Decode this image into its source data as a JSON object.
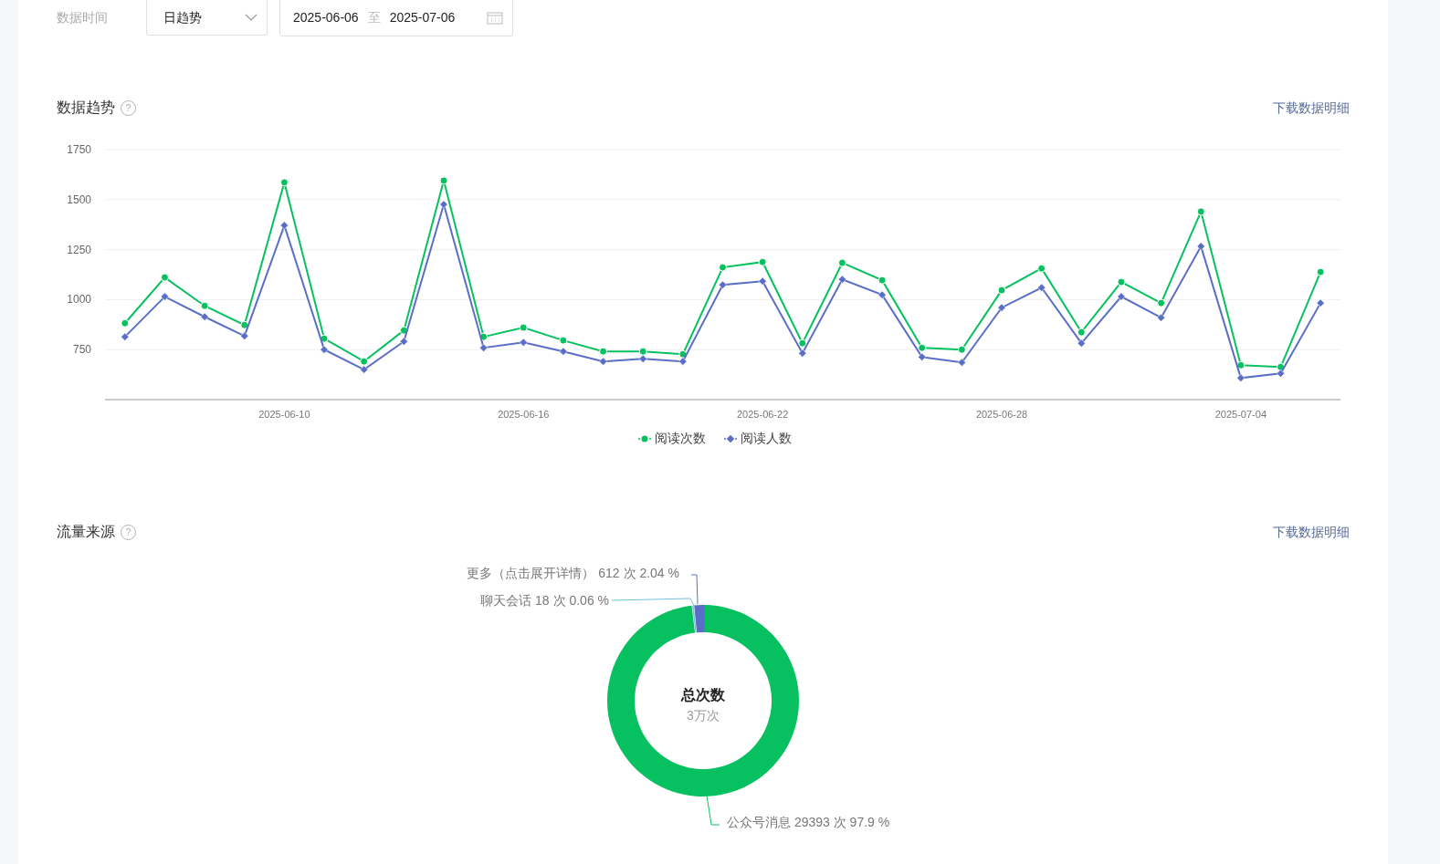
{
  "filter": {
    "label": "数据时间",
    "granularity": "日趋势",
    "date_start": "2025-06-06",
    "separator": "至",
    "date_end": "2025-07-06"
  },
  "trend": {
    "title": "数据趋势",
    "help": "?",
    "download": "下载数据明细",
    "chart_data": {
      "type": "line",
      "grid": true,
      "categories": [
        null,
        null,
        null,
        null,
        "2025-06-10",
        null,
        null,
        null,
        null,
        null,
        "2025-06-16",
        null,
        null,
        null,
        null,
        null,
        "2025-06-22",
        null,
        null,
        null,
        null,
        null,
        "2025-06-28",
        null,
        null,
        null,
        null,
        null,
        "2025-07-04",
        null,
        null
      ],
      "ylim": [
        500,
        1750
      ],
      "yticks": [
        750,
        1000,
        1250,
        1500,
        1750
      ],
      "series": [
        {
          "name": "阅读次数",
          "color": "#07c160",
          "marker": "circle",
          "values": [
            882,
            1111,
            969,
            873,
            1586,
            805,
            691,
            846,
            1595,
            814,
            860,
            796,
            741,
            741,
            727,
            1161,
            1188,
            782,
            1184,
            1097,
            759,
            750,
            1047,
            1156,
            837,
            1088,
            983,
            1440,
            672,
            663,
            1138
          ]
        },
        {
          "name": "阅读人数",
          "color": "#5b6ec7",
          "marker": "diamond",
          "values": [
            814,
            1015,
            914,
            818,
            1371,
            750,
            650,
            791,
            1476,
            759,
            786,
            741,
            691,
            704,
            691,
            1074,
            1092,
            732,
            1101,
            1024,
            713,
            686,
            960,
            1060,
            782,
            1015,
            910,
            1266,
            608,
            631,
            983
          ]
        }
      ]
    }
  },
  "source": {
    "title": "流量来源",
    "help": "?",
    "download": "下载数据明细",
    "center_title": "总次数",
    "center_value": "3万次",
    "chart_data": {
      "type": "donut",
      "values": [
        2.04,
        0.06,
        97.9
      ]
    },
    "slices": [
      {
        "label": "更多（点击展开详情） 612 次 2.04 %",
        "color": "#5b6ec7"
      },
      {
        "label": "聊天会话 18 次 0.06 %",
        "color": "#73c0de"
      },
      {
        "label": "公众号消息 29393 次 97.9 %",
        "color": "#07c160"
      }
    ]
  }
}
